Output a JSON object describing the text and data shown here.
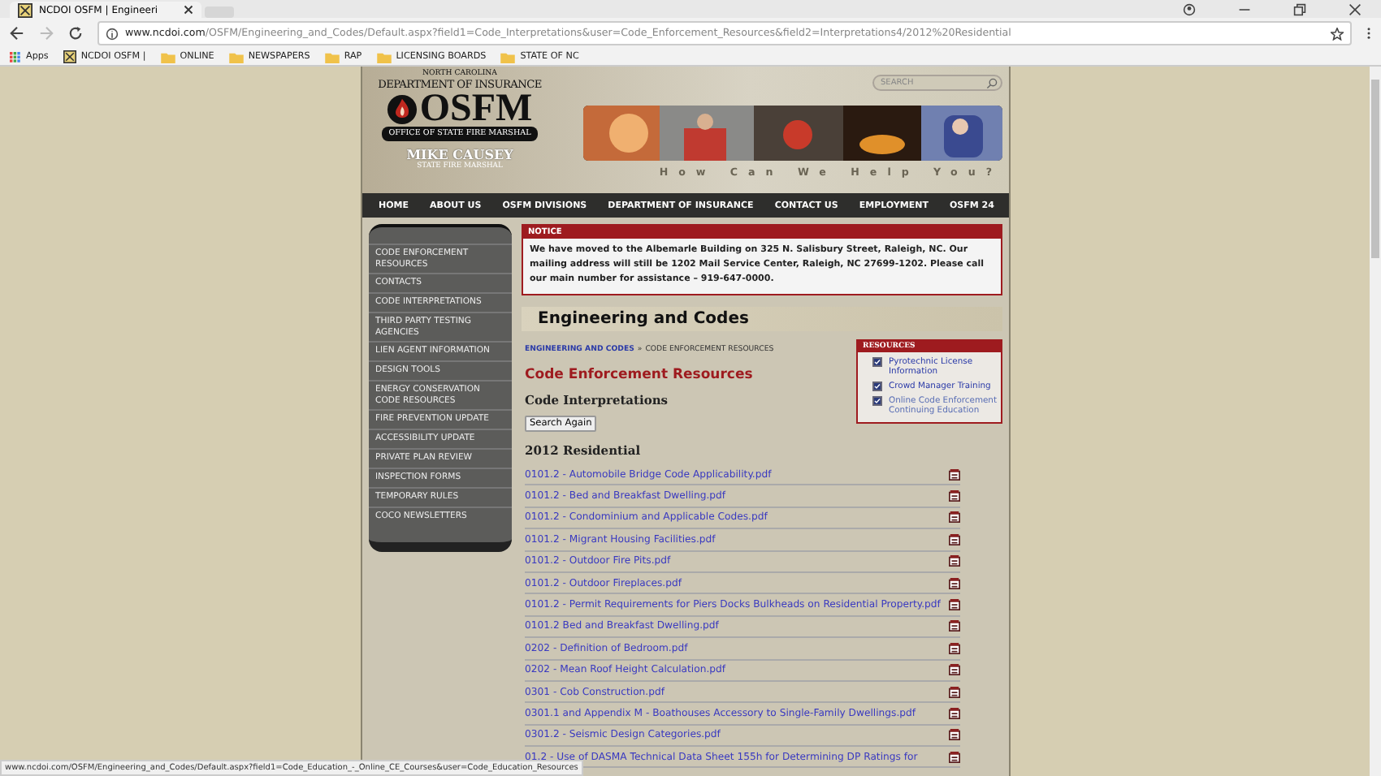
{
  "browser": {
    "tab_title": "NCDOI OSFM | Engineeri",
    "url_host": "www.ncdoi.com",
    "url_path": "/OSFM/Engineering_and_Codes/Default.aspx?field1=Code_Interpretations&user=Code_Enforcement_Resources&field2=Interpretations4/2012%20Residential",
    "apps_label": "Apps",
    "bookmarks": [
      {
        "label": "NCDOI OSFM |",
        "kind": "site"
      },
      {
        "label": "ONLINE",
        "kind": "folder"
      },
      {
        "label": "NEWSPAPERS",
        "kind": "folder"
      },
      {
        "label": "RAP",
        "kind": "folder"
      },
      {
        "label": "LICENSING BOARDS",
        "kind": "folder"
      },
      {
        "label": "STATE OF NC",
        "kind": "folder"
      }
    ]
  },
  "header": {
    "state_line": "NORTH CAROLINA",
    "dept": "DEPARTMENT OF INSURANCE",
    "logo": "OSFM",
    "office": "OFFICE OF STATE FIRE MARSHAL",
    "name": "MIKE CAUSEY",
    "role": "STATE FIRE MARSHAL",
    "search_placeholder": "SEARCH",
    "tagline": "How Can We Help You?"
  },
  "nav": [
    "HOME",
    "ABOUT US",
    "OSFM DIVISIONS",
    "DEPARTMENT OF INSURANCE",
    "CONTACT US",
    "EMPLOYMENT",
    "OSFM 24"
  ],
  "sidebar": [
    "CODE ENFORCEMENT RESOURCES",
    "CONTACTS",
    "CODE INTERPRETATIONS",
    "THIRD PARTY TESTING AGENCIES",
    "LIEN AGENT INFORMATION",
    "DESIGN TOOLS",
    "ENERGY CONSERVATION CODE RESOURCES",
    "FIRE PREVENTION UPDATE",
    "ACCESSIBILITY UPDATE",
    "PRIVATE PLAN REVIEW",
    "INSPECTION FORMS",
    "TEMPORARY RULES",
    "COCO NEWSLETTERS"
  ],
  "notice": {
    "title": "NOTICE",
    "text": "We have moved to the Albemarle Building on 325 N. Salisbury Street, Raleigh, NC. Our mailing address will still be 1202 Mail Service Center, Raleigh, NC 27699-1202. Please call our main number for assistance – 919-647-0000."
  },
  "page_title": "Engineering and Codes",
  "breadcrumb": {
    "link": "ENGINEERING AND CODES",
    "separator": "»",
    "current": "CODE ENFORCEMENT RESOURCES"
  },
  "section_title": "Code Enforcement Resources",
  "subtitle": "Code Interpretations",
  "search_again_button": "Search Again",
  "list_heading": "2012 Residential",
  "resources": {
    "title": "RESOURCES",
    "items": [
      {
        "label": "Pyrotechnic License Information",
        "checked": true
      },
      {
        "label": "Crowd Manager Training",
        "checked": true
      },
      {
        "label": "Online Code Enforcement Continuing Education",
        "checked": true
      }
    ]
  },
  "files": [
    "0101.2 - Automobile Bridge Code Applicability.pdf",
    "0101.2 - Bed and Breakfast Dwelling.pdf",
    "0101.2 - Condominium and Applicable Codes.pdf",
    "0101.2 - Migrant Housing Facilities.pdf",
    "0101.2 - Outdoor Fire Pits.pdf",
    "0101.2 - Outdoor Fireplaces.pdf",
    "0101.2 - Permit Requirements for Piers Docks Bulkheads on Residential Property.pdf",
    "0101.2 Bed and Breakfast Dwelling.pdf",
    "0202 - Definition of Bedroom.pdf",
    "0202 - Mean Roof Height Calculation.pdf",
    "0301 - Cob Construction.pdf",
    "0301.1 and Appendix M - Boathouses Accessory to Single-Family Dwellings.pdf",
    "0301.2 - Seismic Design Categories.pdf",
    "01.2 - Use of DASMA Technical Data Sheet 155h for Determining DP Ratings for"
  ],
  "status_url": "www.ncdoi.com/OSFM/Engineering_and_Codes/Default.aspx?field1=Code_Education_-_Online_CE_Courses&user=Code_Education_Resources"
}
